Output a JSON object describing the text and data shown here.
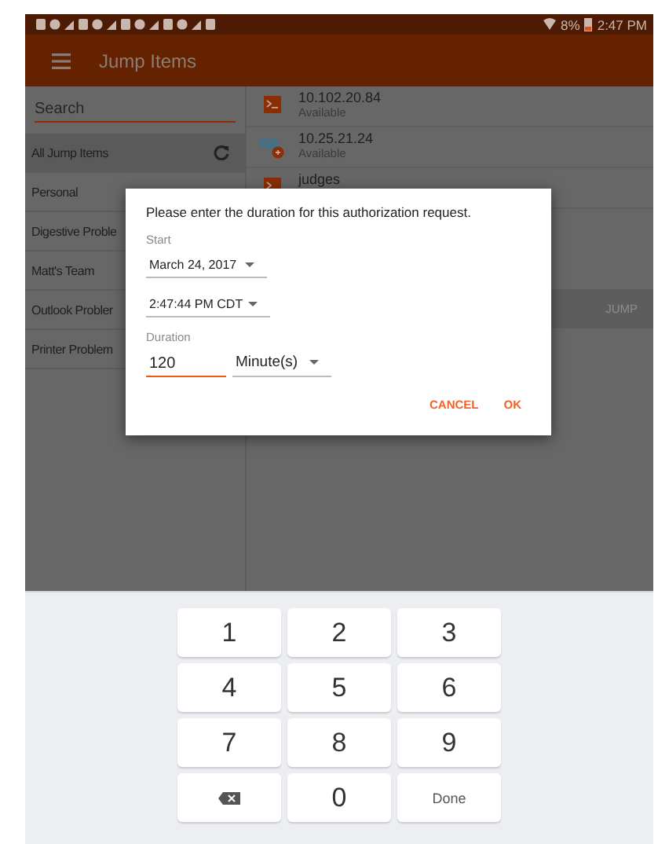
{
  "status_bar": {
    "battery": "8%",
    "time": "2:47 PM"
  },
  "app_bar": {
    "title": "Jump Items"
  },
  "sidebar": {
    "search": {
      "placeholder": "Search"
    },
    "items": [
      {
        "label": "All Jump Items",
        "selected": true,
        "refresh": true
      },
      {
        "label": "Personal",
        "selected": false,
        "refresh": false
      },
      {
        "label": "Digestive Proble",
        "selected": false,
        "refresh": false
      },
      {
        "label": "Matt's Team",
        "selected": false,
        "refresh": false
      },
      {
        "label": "Outlook Probler",
        "selected": false,
        "refresh": false
      },
      {
        "label": "Printer Problem",
        "selected": false,
        "refresh": false
      }
    ]
  },
  "jump_items": [
    {
      "name": "10.102.20.84",
      "status": "Available",
      "kind": "shell"
    },
    {
      "name": "10.25.21.24",
      "status": "Available",
      "kind": "remote"
    },
    {
      "name": "judges",
      "kind": "shell"
    }
  ],
  "action_row": {
    "button": "JUMP",
    "disabled": true
  },
  "dialog": {
    "message": "Please enter the duration for this authorization request.",
    "start_label": "Start",
    "date": "March 24, 2017",
    "time": "2:47:44 PM CDT",
    "duration_label": "Duration",
    "duration": "120",
    "unit": "Minute(s)",
    "buttons": [
      "CANCEL",
      "OK"
    ]
  },
  "keyboard": {
    "keys": [
      {
        "label": "1",
        "kind": "char"
      },
      {
        "label": "2",
        "kind": "char"
      },
      {
        "label": "3",
        "kind": "char"
      },
      {
        "label": "4",
        "kind": "char"
      },
      {
        "label": "5",
        "kind": "char"
      },
      {
        "label": "6",
        "kind": "char"
      },
      {
        "label": "7",
        "kind": "char"
      },
      {
        "label": "8",
        "kind": "char"
      },
      {
        "label": "9",
        "kind": "char"
      },
      {
        "kind": "backspace"
      },
      {
        "label": "0",
        "kind": "char"
      },
      {
        "label": "Done",
        "kind": "action"
      }
    ]
  }
}
